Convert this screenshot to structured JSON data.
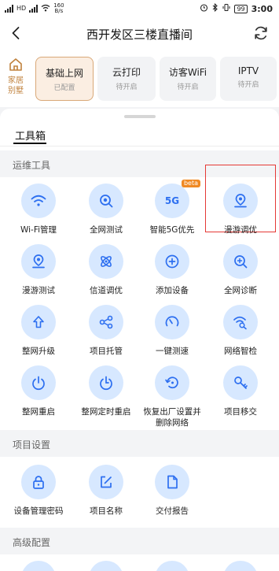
{
  "status_bar": {
    "network_tag": "HD",
    "speed_value": "160",
    "speed_unit": "B/s",
    "battery": "99",
    "time": "3:00"
  },
  "header": {
    "title": "西开发区三楼直播间"
  },
  "home": {
    "label_line1": "家居",
    "label_line2": "别墅"
  },
  "services": [
    {
      "name": "基础上网",
      "status": "已配置"
    },
    {
      "name": "云打印",
      "status": "待开启"
    },
    {
      "name": "访客WiFi",
      "status": "待开启"
    },
    {
      "name": "IPTV",
      "status": "待开启"
    }
  ],
  "tab": "工具箱",
  "sections": {
    "ops": "运维工具",
    "project": "项目设置",
    "advanced": "高级配置"
  },
  "ops_tools": [
    {
      "label": "Wi-Fi管理",
      "icon": "wifi-icon"
    },
    {
      "label": "全网测试",
      "icon": "search-target-icon"
    },
    {
      "label": "智能5G优先",
      "icon": "5g-icon",
      "badge": "beta",
      "icon_text": "5G"
    },
    {
      "label": "漫游调优",
      "icon": "location-pin-icon"
    },
    {
      "label": "漫游测试",
      "icon": "location-pin-icon"
    },
    {
      "label": "信道调优",
      "icon": "atom-icon"
    },
    {
      "label": "添加设备",
      "icon": "add-circle-icon"
    },
    {
      "label": "全网诊断",
      "icon": "zoom-search-icon"
    },
    {
      "label": "整网升级",
      "icon": "upgrade-arrow-icon"
    },
    {
      "label": "项目托管",
      "icon": "share-nodes-icon"
    },
    {
      "label": "一键测速",
      "icon": "speedometer-icon"
    },
    {
      "label": "网络智检",
      "icon": "wifi-search-icon"
    },
    {
      "label": "整网重启",
      "icon": "power-icon"
    },
    {
      "label": "整网定时重启",
      "icon": "timer-power-icon"
    },
    {
      "label_line1": "恢复出厂设置并",
      "label_line2": "删除网络",
      "icon": "restore-icon"
    },
    {
      "label": "项目移交",
      "icon": "key-icon"
    }
  ],
  "project_tools": [
    {
      "label": "设备管理密码",
      "icon": "lock-icon"
    },
    {
      "label": "项目名称",
      "icon": "edit-icon"
    },
    {
      "label": "交付报告",
      "icon": "document-icon"
    }
  ],
  "colors": {
    "accent": "#2d6ff0",
    "icon_bg": "#d7e8ff",
    "home": "#c0813c",
    "highlight": "#e53935",
    "beta": "#f08a24"
  }
}
